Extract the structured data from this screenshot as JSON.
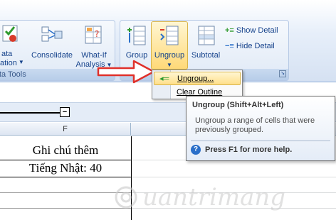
{
  "ribbon": {
    "data_tools": {
      "text_to_columns_partial": "ata",
      "text_to_columns_partial2": "ation",
      "consolidate_label": "Consolidate",
      "whatif_label_1": "What-If",
      "whatif_label_2": "Analysis",
      "group_title": "ta Tools"
    },
    "outline": {
      "group_label": "Group",
      "ungroup_label": "Ungroup",
      "subtotal_label": "Subtotal",
      "show_detail_label": "Show Detail",
      "hide_detail_label": "Hide Detail"
    }
  },
  "ungroup_menu": {
    "items": [
      {
        "label": "Ungroup..."
      },
      {
        "label": "Clear Outline"
      }
    ]
  },
  "tooltip": {
    "title": "Ungroup (Shift+Alt+Left)",
    "description": "Ungroup a range of cells that were previously grouped.",
    "help": "Press F1 for more help."
  },
  "sheet": {
    "column_label": "F",
    "collapse_symbol": "−",
    "cells": [
      "Ghi chú thêm",
      "Tiếng Nhật: 40"
    ]
  },
  "watermark": {
    "text": "uantrimang"
  },
  "colors": {
    "ribbon_text": "#15428b",
    "highlight": "#ffe9a8",
    "arrow": "#e0302a"
  }
}
